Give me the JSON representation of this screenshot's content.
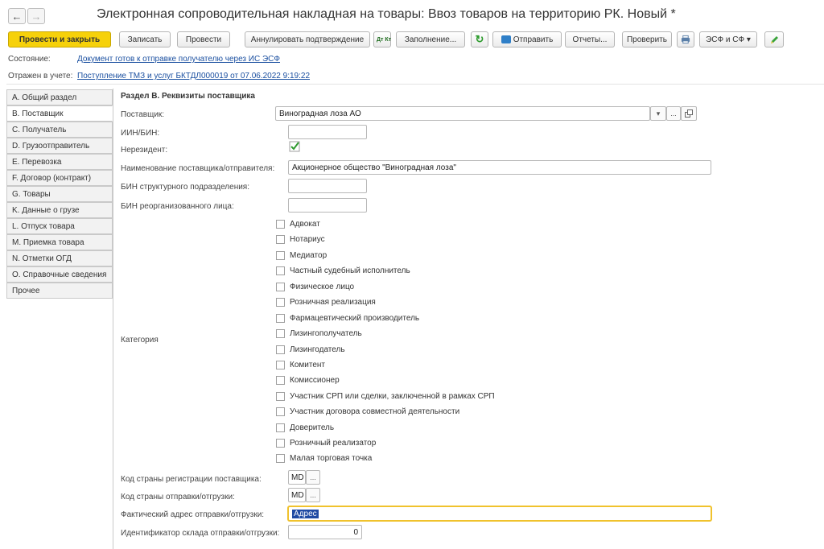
{
  "window": {
    "title": "Электронная сопроводительная накладная на товары: Ввоз товаров на территорию РК. Новый *",
    "nav_back": "←",
    "nav_forward": "→"
  },
  "toolbar": {
    "post_and_close": "Провести и закрыть",
    "save": "Записать",
    "post": "Провести",
    "cancel_confirmation": "Аннулировать подтверждение",
    "dt_kt_icon": "Дт Кт",
    "fill": "Заполнение...",
    "refresh_icon": "↻",
    "send": "Отправить",
    "reports": "Отчеты...",
    "check": "Проверить",
    "esf_sf": "ЭСФ и СФ ▾"
  },
  "status": {
    "state_label": "Состояние:",
    "state_link": "Документ готов к отправке получателю через ИС ЭСФ",
    "reflected_label": "Отражен в учете:",
    "reflected_link": "Поступление ТМЗ и услуг БКТДЛ000019 от 07.06.2022 9:19:22"
  },
  "tabs": [
    "А. Общий раздел",
    "В. Поставщик",
    "С. Получатель",
    "D. Грузоотправитель",
    "E. Перевозка",
    "F. Договор (контракт)",
    "G. Товары",
    "K. Данные о грузе",
    "L. Отпуск товара",
    "M. Приемка товара",
    "N. Отметки ОГД",
    "O. Справочные сведения",
    "Прочее"
  ],
  "section": {
    "title": "Раздел B. Реквизиты поставщика",
    "supplier_label": "Поставщик:",
    "supplier_value": "Виноградная лоза АО",
    "iin_label": "ИИН/БИН:",
    "iin_value": "",
    "nonresident_label": "Нерезидент:",
    "nonresident_checked": true,
    "name_label": "Наименование поставщика/отправителя:",
    "name_value": "Акционерное общество \"Виноградная лоза\"",
    "struct_bin_label": "БИН структурного подразделения:",
    "struct_bin_value": "",
    "reorg_bin_label": "БИН реорганизованного лица:",
    "reorg_bin_value": "",
    "category_label": "Категория",
    "categories": [
      "Адвокат",
      "Нотариус",
      "Медиатор",
      "Частный судебный исполнитель",
      "Физическое лицо",
      "Розничная реализация",
      "Фармацевтический производитель",
      "Лизингополучатель",
      "Лизингодатель",
      "Комитент",
      "Комиссионер",
      "Участник СРП или сделки, заключенной в рамках СРП",
      "Участник договора совместной деятельности",
      "Доверитель",
      "Розничный реализатор",
      "Малая торговая точка"
    ],
    "reg_country_label": "Код страны регистрации поставщика:",
    "reg_country_value": "MD",
    "ship_country_label": "Код страны отправки/отгрузки:",
    "ship_country_value": "MD",
    "address_label": "Фактический адрес отправки/отгрузки:",
    "address_value": "Адрес",
    "warehouse_label": "Идентификатор склада отправки/отгрузки:",
    "warehouse_value": "0",
    "dots": "...",
    "dropdown_arrow": "▾"
  }
}
